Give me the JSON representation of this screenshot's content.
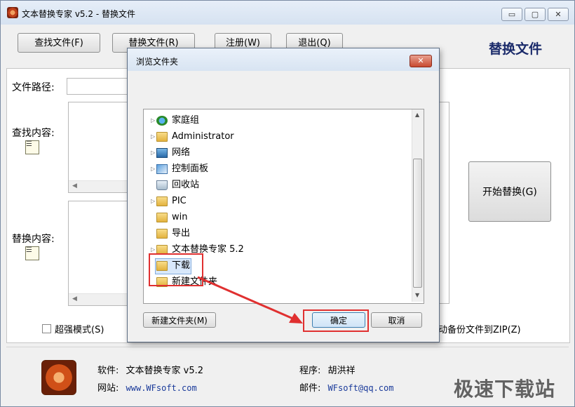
{
  "window": {
    "title": "文本替换专家 v5.2  -  替换文件",
    "minimize_glyph": "▭",
    "maximize_glyph": "▢",
    "close_glyph": "✕"
  },
  "toolbar": {
    "find_file": "查找文件(F)",
    "replace_file": "替换文件(R)",
    "register": "注册(W)",
    "exit": "退出(Q)",
    "mode_title": "替换文件"
  },
  "form": {
    "file_path_label": "文件路径:",
    "file_path_value": "",
    "find_label": "查找内容:",
    "replace_label": "替换内容:",
    "start_button": "开始替换(G)",
    "super_mode_label": "超强模式(S)",
    "auto_backup_label": "动备份文件到ZIP(Z)"
  },
  "dialog": {
    "title": "浏览文件夹",
    "close_glyph": "✕",
    "items": [
      {
        "label": "家庭组",
        "icon": "homegroup-icon",
        "has_arrow": true
      },
      {
        "label": "Administrator",
        "icon": "user-folder-icon",
        "has_arrow": true
      },
      {
        "label": "网络",
        "icon": "network-icon",
        "has_arrow": true
      },
      {
        "label": "控制面板",
        "icon": "control-panel-icon",
        "has_arrow": true
      },
      {
        "label": "回收站",
        "icon": "recycle-bin-icon",
        "has_arrow": false
      },
      {
        "label": "PIC",
        "icon": "folder-icon",
        "has_arrow": true
      },
      {
        "label": "win",
        "icon": "folder-icon",
        "has_arrow": false
      },
      {
        "label": "导出",
        "icon": "folder-icon",
        "has_arrow": false
      },
      {
        "label": "文本替换专家 5.2",
        "icon": "folder-icon",
        "has_arrow": true
      },
      {
        "label": "下载",
        "icon": "folder-icon",
        "has_arrow": false,
        "selected": true
      },
      {
        "label": "新建文件夹",
        "icon": "folder-icon",
        "has_arrow": false
      }
    ],
    "new_folder_button": "新建文件夹(M)",
    "ok_button": "确定",
    "cancel_button": "取消"
  },
  "footer": {
    "software_label": "软件:",
    "software_value": "文本替换专家 v5.2",
    "website_label": "网站:",
    "website_value": "www.WFsoft.com",
    "author_label": "程序:",
    "author_value": "胡洪祥",
    "email_label": "邮件:",
    "email_value": "WFsoft@qq.com"
  },
  "watermark": "极速下载站",
  "colors": {
    "annotation_red": "#e03030",
    "selection_blue": "#d8e8fb",
    "title_navy": "#1a2a6a"
  }
}
